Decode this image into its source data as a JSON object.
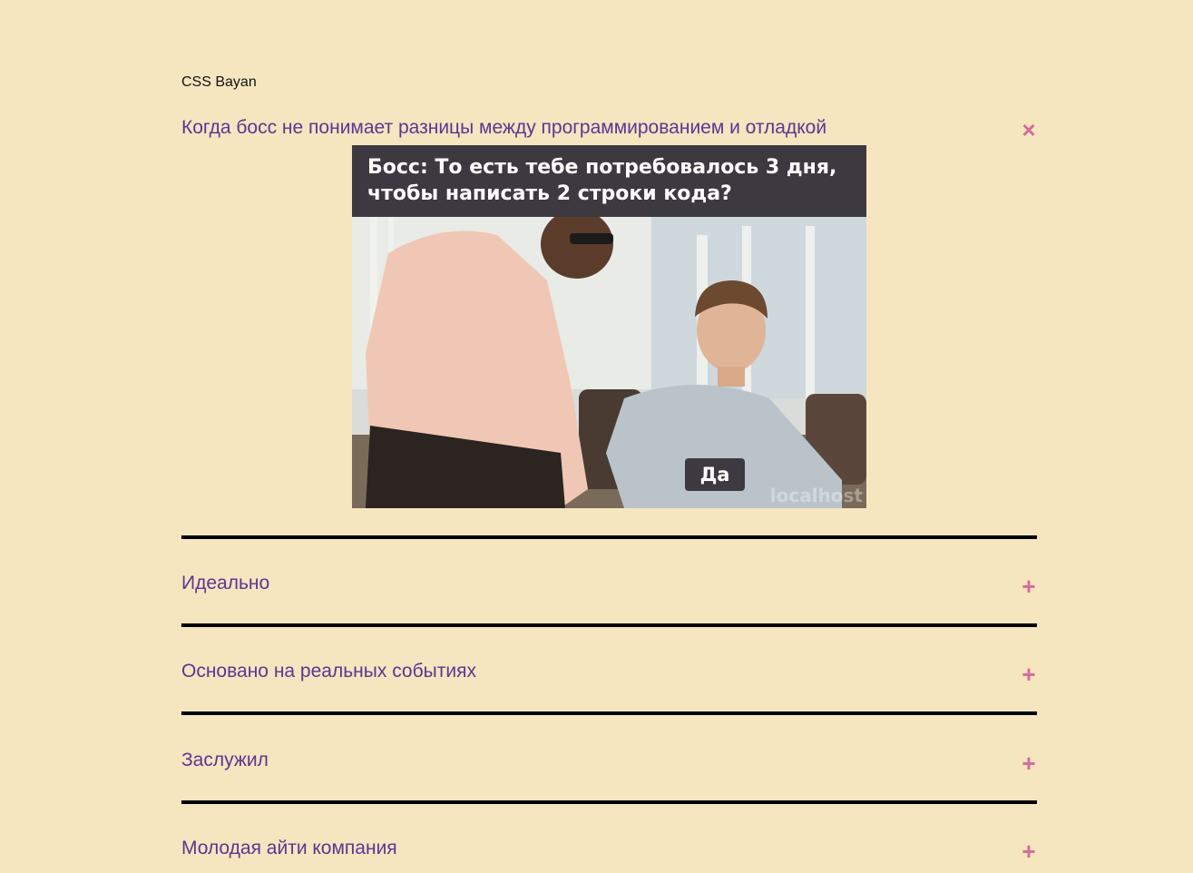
{
  "page": {
    "title": "CSS Bayan"
  },
  "accordion": {
    "items": [
      {
        "label": "Когда босс не понимает разницы между программированием и отладкой",
        "toggle_icon": "×",
        "expanded": true,
        "meme": {
          "caption": "Босс: То есть тебе потребовалось 3 дня, чтобы написать 2 строки кода?",
          "answer": "Да",
          "watermark": "localhost"
        }
      },
      {
        "label": "Идеально",
        "toggle_icon": "+",
        "expanded": false
      },
      {
        "label": "Основано на реальных событиях",
        "toggle_icon": "+",
        "expanded": false
      },
      {
        "label": "Заслужил",
        "toggle_icon": "+",
        "expanded": false
      },
      {
        "label": "Молодая айти компания",
        "toggle_icon": "+",
        "expanded": false
      }
    ]
  },
  "colors": {
    "background": "#f5e6bf",
    "label": "#5f3493",
    "toggle": "#d46a9d",
    "divider": "#000000",
    "caption_bg": "#3d3940"
  }
}
